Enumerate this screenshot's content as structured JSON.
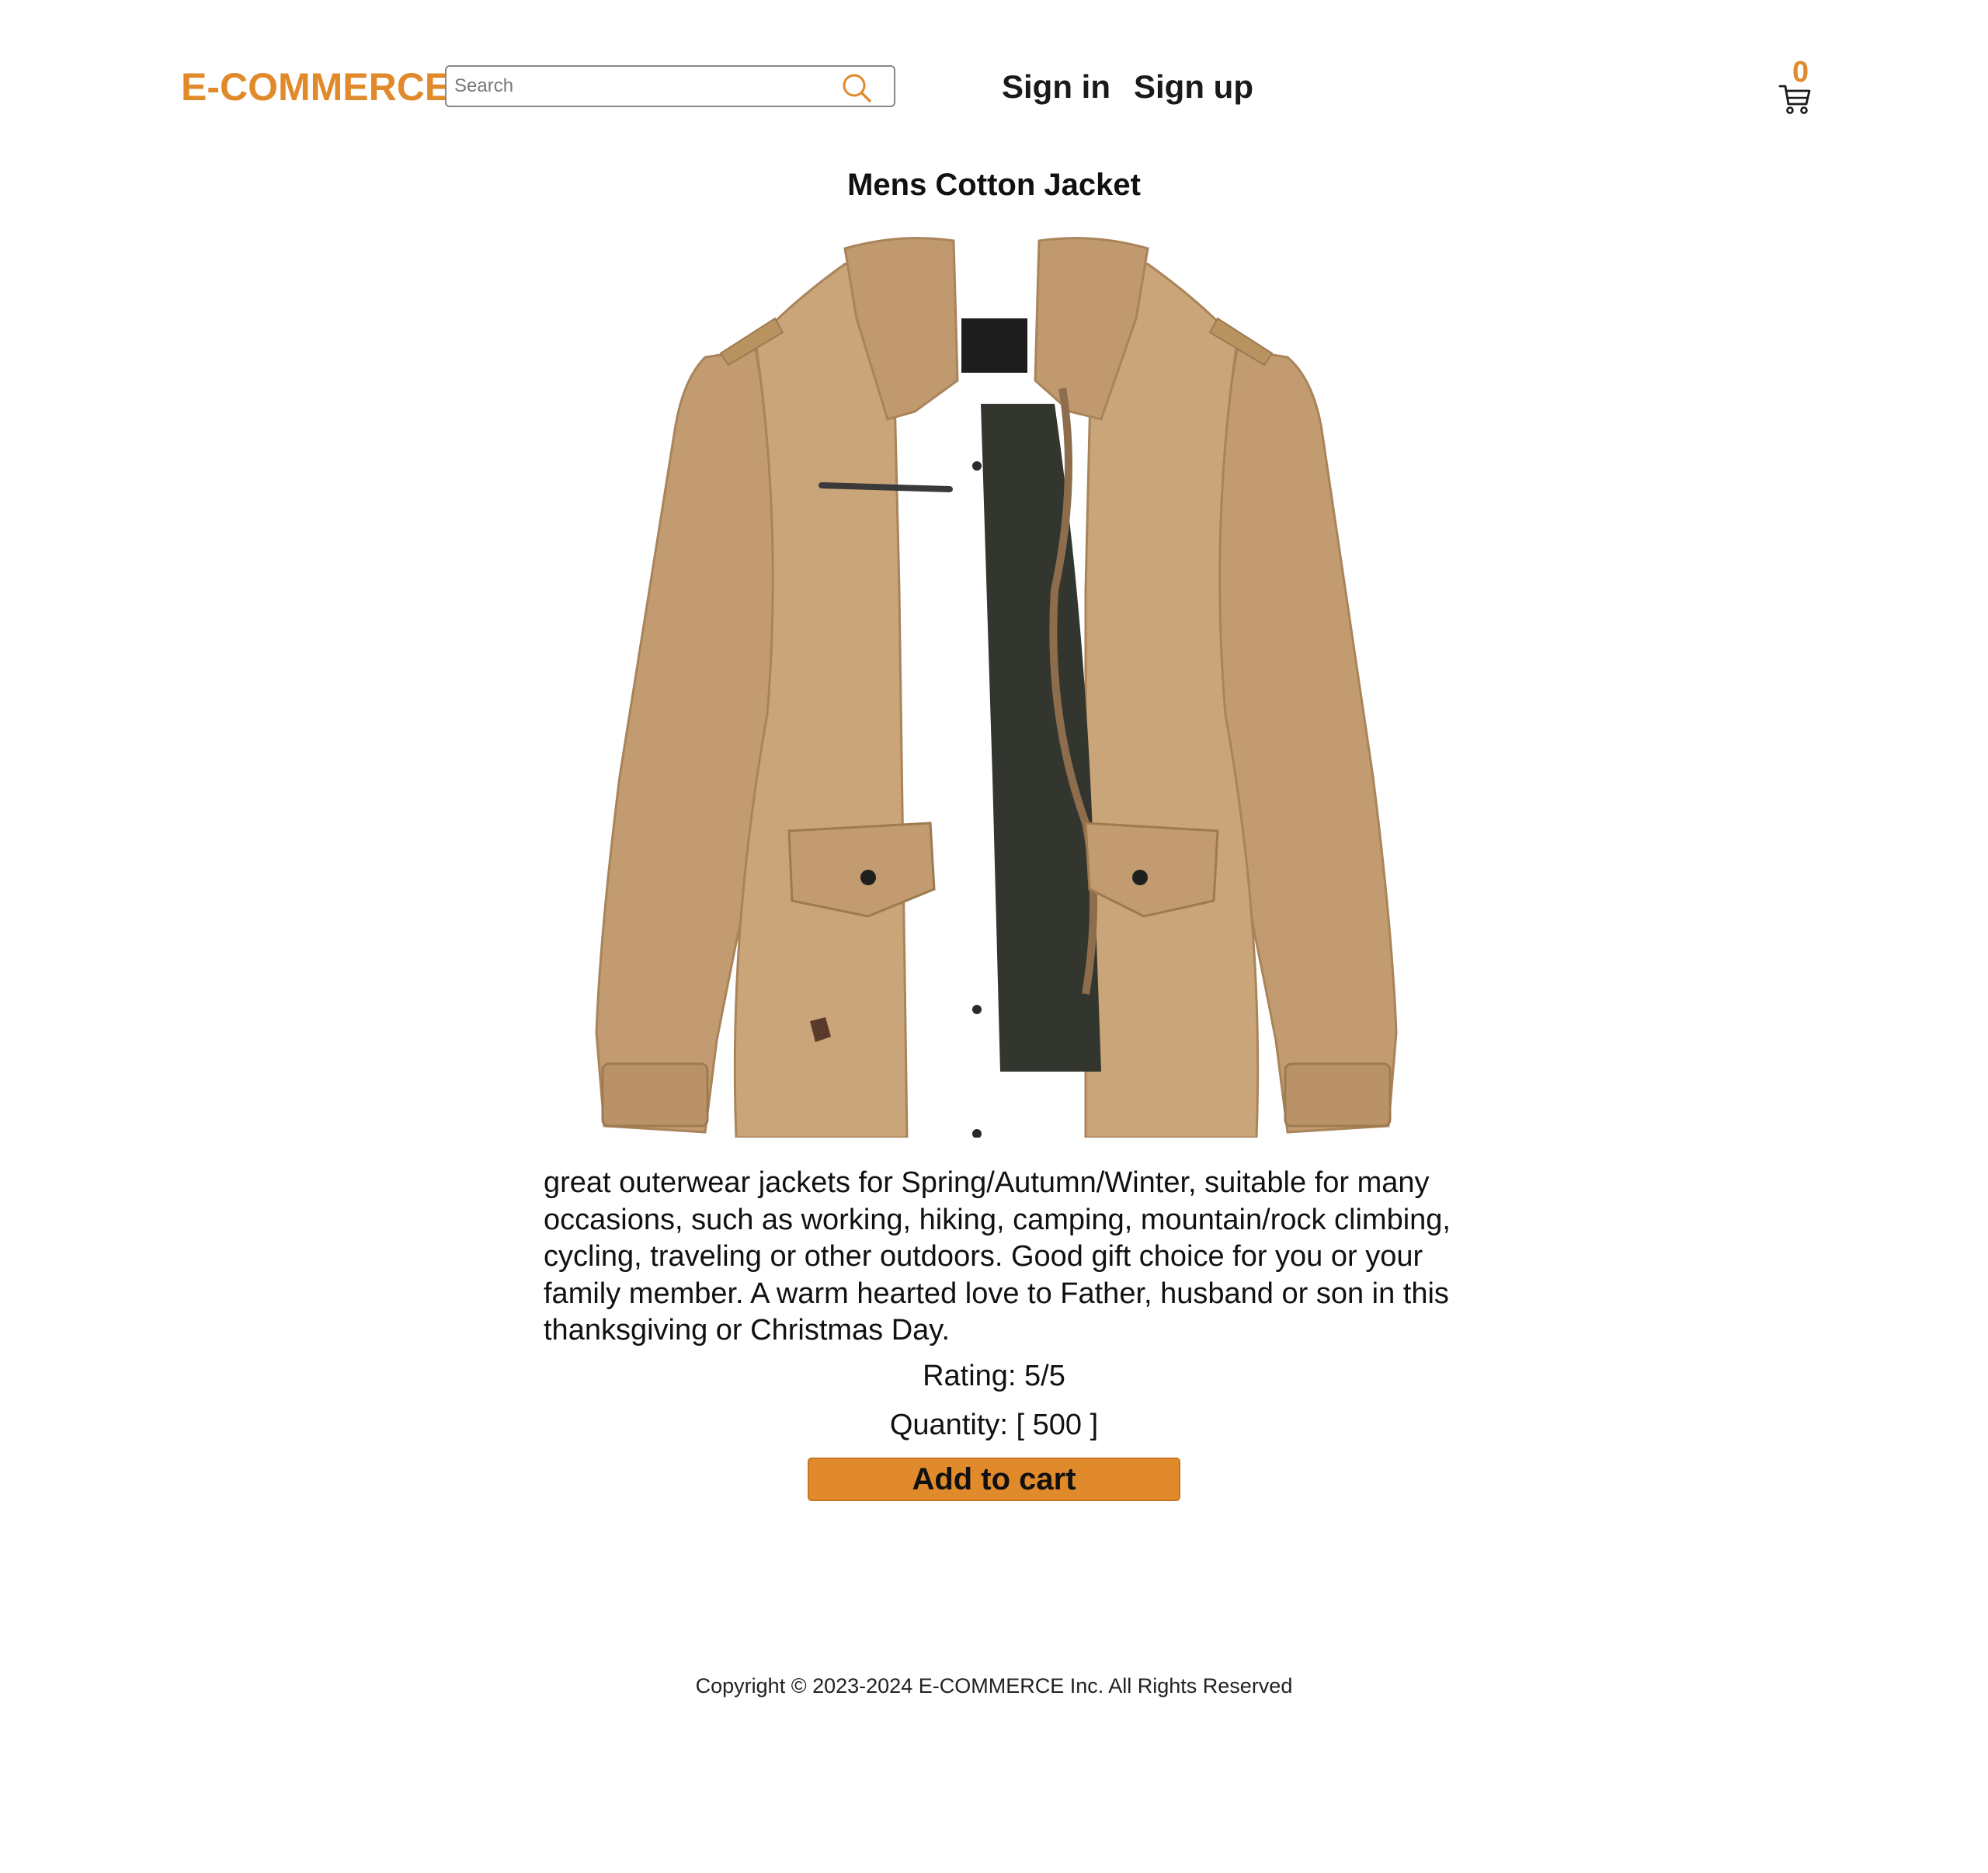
{
  "header": {
    "logo": "E-COMMERCE",
    "search_placeholder": "Search",
    "nav": {
      "sign_in": "Sign in",
      "sign_up": "Sign up"
    },
    "cart_count": "0"
  },
  "product": {
    "title": "Mens Cotton Jacket",
    "image_alt": "Mens Cotton Jacket",
    "description": "great outerwear jackets for Spring/Autumn/Winter, suitable for many occasions, such as working, hiking, camping, mountain/rock climbing, cycling, traveling or other outdoors. Good gift choice for you or your family member. A warm hearted love to Father, husband or son in this thanksgiving or Christmas Day.",
    "rating_text": "Rating: 5/5",
    "quantity_text": "Quantity: [ 500 ]",
    "add_to_cart_label": "Add to cart"
  },
  "footer": {
    "copyright": "Copyright © 2023-2024 E-COMMERCE Inc. All Rights Reserved"
  },
  "colors": {
    "brand": "#e08a2c",
    "jacket": "#c9a47a",
    "lining": "#33362f"
  },
  "icons": {
    "search": "search-icon",
    "cart": "cart-icon"
  }
}
